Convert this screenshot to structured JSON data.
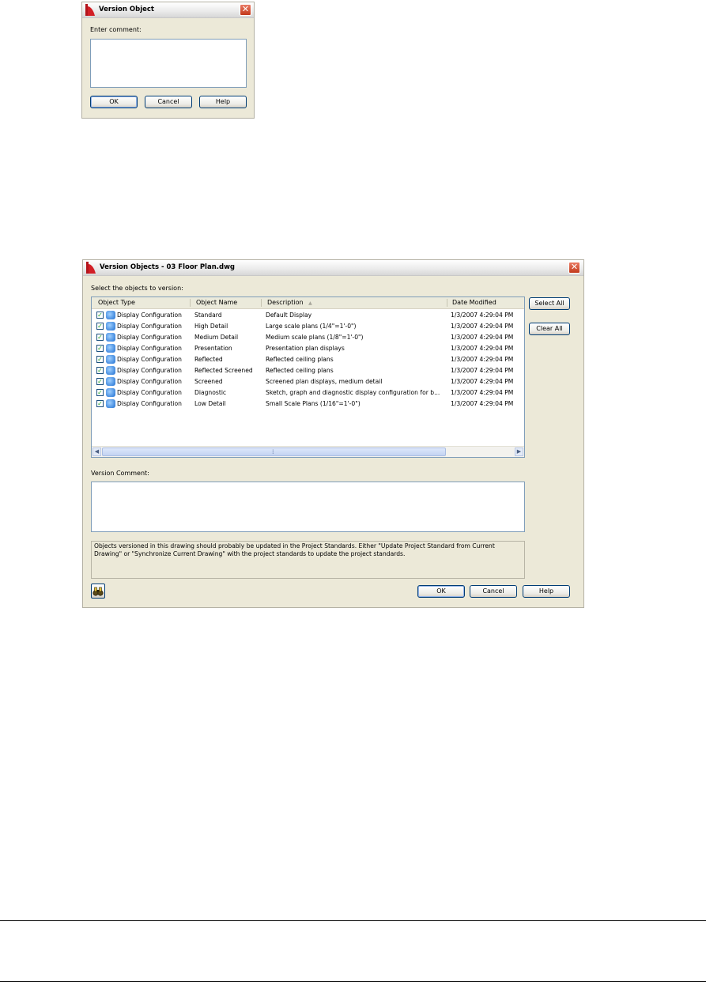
{
  "small_dialog": {
    "title": "Version Object",
    "close_glyph": "✕",
    "comment_label": "Enter comment:",
    "comment_value": "",
    "ok_label": "OK",
    "cancel_label": "Cancel",
    "help_label": "Help"
  },
  "main_dialog": {
    "title": "Version Objects - 03 Floor Plan.dwg",
    "close_glyph": "✕",
    "select_label": "Select the objects to version:",
    "columns": {
      "object_type": "Object Type",
      "object_name": "Object Name",
      "description": "Description",
      "date_modified": "Date Modified",
      "sort_indicator": "▲"
    },
    "rows": [
      {
        "checked": true,
        "type": "Display Configuration",
        "name": "Standard",
        "description": "Default Display",
        "date": "1/3/2007 4:29:04 PM"
      },
      {
        "checked": true,
        "type": "Display Configuration",
        "name": "High Detail",
        "description": "Large scale plans (1/4\"=1'-0\")",
        "date": "1/3/2007 4:29:04 PM"
      },
      {
        "checked": true,
        "type": "Display Configuration",
        "name": "Medium Detail",
        "description": "Medium scale plans (1/8\"=1'-0\")",
        "date": "1/3/2007 4:29:04 PM"
      },
      {
        "checked": true,
        "type": "Display Configuration",
        "name": "Presentation",
        "description": "Presentation plan displays",
        "date": "1/3/2007 4:29:04 PM"
      },
      {
        "checked": true,
        "type": "Display Configuration",
        "name": "Reflected",
        "description": "Reflected ceiling plans",
        "date": "1/3/2007 4:29:04 PM"
      },
      {
        "checked": true,
        "type": "Display Configuration",
        "name": "Reflected Screened",
        "description": "Reflected ceiling plans",
        "date": "1/3/2007 4:29:04 PM"
      },
      {
        "checked": true,
        "type": "Display Configuration",
        "name": "Screened",
        "description": "Screened plan displays, medium detail",
        "date": "1/3/2007 4:29:04 PM"
      },
      {
        "checked": true,
        "type": "Display Configuration",
        "name": "Diagnostic",
        "description": "Sketch, graph and diagnostic display configuration for b...",
        "date": "1/3/2007 4:29:04 PM"
      },
      {
        "checked": true,
        "type": "Display Configuration",
        "name": "Low Detail",
        "description": "Small Scale Plans (1/16\"=1'-0\")",
        "date": "1/3/2007 4:29:04 PM"
      }
    ],
    "check_glyph": "✓",
    "select_all_label": "Select All",
    "clear_all_label": "Clear All",
    "version_comment_label": "Version Comment:",
    "version_comment_value": "",
    "info_text": "Objects versioned in this drawing should probably be updated in the Project Standards. Either \"Update Project Standard from Current Drawing\" or \"Synchronize Current Drawing\" with the project standards to update the project standards.",
    "ok_label": "OK",
    "cancel_label": "Cancel",
    "help_label": "Help",
    "scroll_glyphs": {
      "left": "◀",
      "right": "▶",
      "up": "▲",
      "down": "▼",
      "grip": "⁞"
    }
  }
}
